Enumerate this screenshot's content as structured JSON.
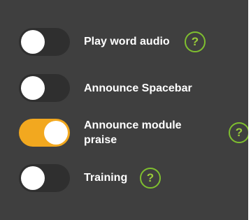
{
  "settings": {
    "items": [
      {
        "label": "Play word audio",
        "toggle_on": false,
        "has_help": true,
        "help_glyph": "?"
      },
      {
        "label": "Announce Spacebar",
        "toggle_on": false,
        "has_help": false
      },
      {
        "label": "Announce module praise",
        "toggle_on": true,
        "has_help": true,
        "help_glyph": "?"
      },
      {
        "label": "Training",
        "toggle_on": false,
        "has_help": true,
        "help_glyph": "?"
      }
    ]
  },
  "colors": {
    "panel_bg": "#3f3f3f",
    "toggle_off": "#2f2f2f",
    "toggle_on": "#f2a81f",
    "help_accent": "#8dc63f",
    "text": "#ffffff"
  },
  "icons": {
    "help": "question-circle-icon"
  }
}
